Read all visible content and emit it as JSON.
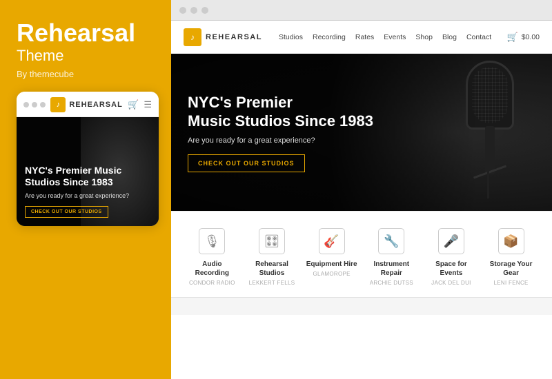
{
  "left": {
    "title_bold": "Rehearsal",
    "title_light": "Theme",
    "by": "By themecube",
    "dots": [
      "dot1",
      "dot2",
      "dot3"
    ],
    "mobile": {
      "logo_text": "REHEARSAL",
      "hero_title": "NYC's Premier Music Studios Since 1983",
      "hero_sub": "Are you ready for a great experience?",
      "cta_label": "CHECK OUT OUR STUDIOS"
    }
  },
  "right": {
    "browser_dots": [
      "d1",
      "d2",
      "d3"
    ],
    "nav": {
      "logo_text": "REHEARSAL",
      "links": [
        "Studios",
        "Recording",
        "Rates",
        "Events",
        "Shop",
        "Blog",
        "Contact"
      ],
      "cart_amount": "$0.00"
    },
    "hero": {
      "title_line1": "NYC's Premier",
      "title_line2": "Music Studios Since 1983",
      "subtitle": "Are you ready for a great experience?",
      "cta_label": "CHECK OUT OUR STUDIOS"
    },
    "features": [
      {
        "icon": "🎙️",
        "title": "Audio Recording",
        "subtitle": "CONDOR RADIO"
      },
      {
        "icon": "🎛️",
        "title": "Rehearsal Studios",
        "subtitle": "LEKKERT FELLS"
      },
      {
        "icon": "🎸",
        "title": "Equipment Hire",
        "subtitle": "GLAMOROPE"
      },
      {
        "icon": "🔧",
        "title": "Instrument Repair",
        "subtitle": "ARCHIE DUTSS"
      },
      {
        "icon": "🎤",
        "title": "Space for Events",
        "subtitle": "JACK DEL DUI"
      },
      {
        "icon": "📦",
        "title": "Storage Your Gear",
        "subtitle": "LENI FENCE"
      }
    ]
  }
}
